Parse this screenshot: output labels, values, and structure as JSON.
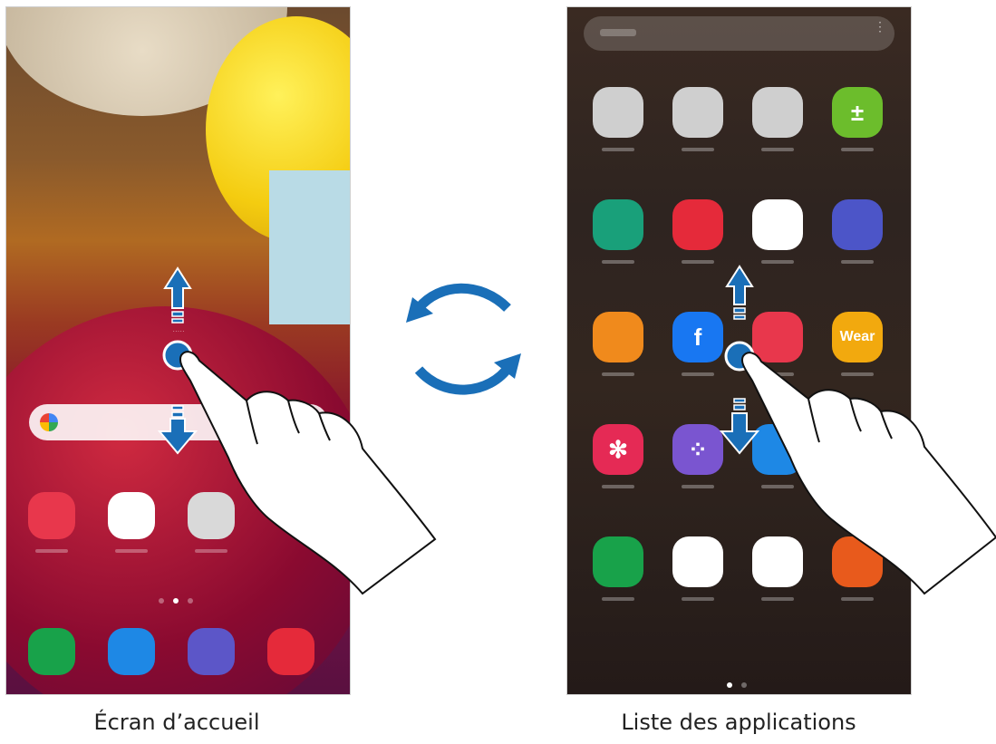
{
  "captions": {
    "home": "Écran d’accueil",
    "apps": "Liste des applications"
  },
  "home": {
    "dock": [
      {
        "icon": "phone-icon",
        "color": "#18a24a"
      },
      {
        "icon": "messages-icon",
        "color": "#1e88e5"
      },
      {
        "icon": "internet-icon",
        "color": "#5c56c8"
      },
      {
        "icon": "camera-icon",
        "color": "#e52a3a"
      }
    ],
    "favorites": [
      {
        "icon": "galaxy-store-icon",
        "color": "#e8374c"
      },
      {
        "icon": "play-store-icon",
        "color": "#ffffff"
      },
      {
        "icon": "google-folder-icon",
        "color": "#d9d9d9"
      }
    ]
  },
  "apps": {
    "rows": [
      [
        {
          "icon": "google-folder-icon",
          "color": "#cfcfcf"
        },
        {
          "icon": "microsoft-folder-icon",
          "color": "#cfcfcf"
        },
        {
          "icon": "samsung-folder-icon",
          "color": "#cfcfcf"
        },
        {
          "icon": "calculator-icon",
          "color": "#6cbd2c",
          "glyph": "±"
        }
      ],
      [
        {
          "icon": "calendar-icon",
          "color": "#19a07a"
        },
        {
          "icon": "camera-icon",
          "color": "#e52a3a"
        },
        {
          "icon": "chrome-icon",
          "color": "#ffffff"
        },
        {
          "icon": "clock-icon",
          "color": "#4c55c8"
        }
      ],
      [
        {
          "icon": "contacts-icon",
          "color": "#f08a1c"
        },
        {
          "icon": "facebook-icon",
          "color": "#1877f2",
          "glyph": "f"
        },
        {
          "icon": "galaxy-store-icon",
          "color": "#e8374c"
        },
        {
          "icon": "galaxy-wearable-icon",
          "color": "#f2a90e",
          "glyph": "Wear"
        }
      ],
      [
        {
          "icon": "gallery-icon",
          "color": "#e52a55",
          "glyph": "✻"
        },
        {
          "icon": "game-launcher-icon",
          "color": "#7a55d0",
          "glyph": "⁘"
        },
        {
          "icon": "messages-icon",
          "color": "#1e88e5"
        },
        {
          "icon": "blank-icon",
          "color": "transparent"
        }
      ],
      [
        {
          "icon": "phone-icon",
          "color": "#18a24a"
        },
        {
          "icon": "play-store-icon",
          "color": "#ffffff"
        },
        {
          "icon": "samsung-global-goals-icon",
          "color": "#ffffff"
        },
        {
          "icon": "samsung-notes-icon",
          "color": "#e85a1c"
        }
      ]
    ]
  },
  "arrow_color": "#1a6fb8"
}
